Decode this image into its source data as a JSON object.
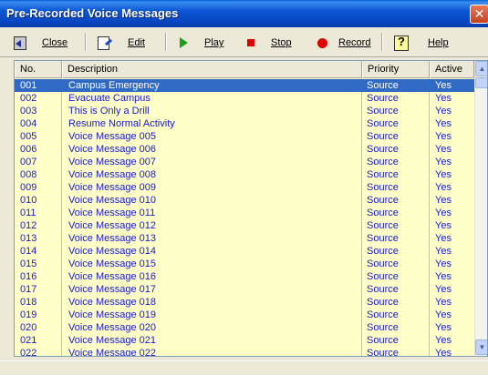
{
  "window": {
    "title": "Pre-Recorded Voice Messages",
    "close_glyph": "✕"
  },
  "toolbar": {
    "close_label": "Close",
    "edit_label": "Edit",
    "play_label": "Play",
    "stop_label": "Stop",
    "record_label": "Record",
    "help_label": "Help",
    "icons": [
      "close-door-icon",
      "edit-icon",
      "play-icon",
      "stop-icon",
      "record-icon",
      "help-icon"
    ],
    "colors": {
      "play": "#1ca01c",
      "stop": "#e00000",
      "record": "#e00000"
    }
  },
  "list": {
    "columns": [
      "No.",
      "Description",
      "Priority",
      "Active"
    ],
    "selected_index": 0,
    "colors": {
      "row_text": "#1a1ad0",
      "selected_bg": "#316ac5",
      "background": "#ffffc8"
    },
    "rows": [
      {
        "no": "001",
        "description": "Campus Emergency",
        "priority": "Source",
        "active": "Yes"
      },
      {
        "no": "002",
        "description": "Evacuate Campus",
        "priority": "Source",
        "active": "Yes"
      },
      {
        "no": "003",
        "description": "This is Only a Drill",
        "priority": "Source",
        "active": "Yes"
      },
      {
        "no": "004",
        "description": "Resume Normal Activity",
        "priority": "Source",
        "active": "Yes"
      },
      {
        "no": "005",
        "description": "Voice Message 005",
        "priority": "Source",
        "active": "Yes"
      },
      {
        "no": "006",
        "description": "Voice Message 006",
        "priority": "Source",
        "active": "Yes"
      },
      {
        "no": "007",
        "description": "Voice Message 007",
        "priority": "Source",
        "active": "Yes"
      },
      {
        "no": "008",
        "description": "Voice Message 008",
        "priority": "Source",
        "active": "Yes"
      },
      {
        "no": "009",
        "description": "Voice Message 009",
        "priority": "Source",
        "active": "Yes"
      },
      {
        "no": "010",
        "description": "Voice Message 010",
        "priority": "Source",
        "active": "Yes"
      },
      {
        "no": "011",
        "description": "Voice Message 011",
        "priority": "Source",
        "active": "Yes"
      },
      {
        "no": "012",
        "description": "Voice Message 012",
        "priority": "Source",
        "active": "Yes"
      },
      {
        "no": "013",
        "description": "Voice Message 013",
        "priority": "Source",
        "active": "Yes"
      },
      {
        "no": "014",
        "description": "Voice Message 014",
        "priority": "Source",
        "active": "Yes"
      },
      {
        "no": "015",
        "description": "Voice Message 015",
        "priority": "Source",
        "active": "Yes"
      },
      {
        "no": "016",
        "description": "Voice Message 016",
        "priority": "Source",
        "active": "Yes"
      },
      {
        "no": "017",
        "description": "Voice Message 017",
        "priority": "Source",
        "active": "Yes"
      },
      {
        "no": "018",
        "description": "Voice Message 018",
        "priority": "Source",
        "active": "Yes"
      },
      {
        "no": "019",
        "description": "Voice Message 019",
        "priority": "Source",
        "active": "Yes"
      },
      {
        "no": "020",
        "description": "Voice Message 020",
        "priority": "Source",
        "active": "Yes"
      },
      {
        "no": "021",
        "description": "Voice Message 021",
        "priority": "Source",
        "active": "Yes"
      },
      {
        "no": "022",
        "description": "Voice Message 022",
        "priority": "Source",
        "active": "Yes"
      }
    ]
  },
  "scrollbar": {
    "up_glyph": "▲",
    "down_glyph": "▼"
  }
}
